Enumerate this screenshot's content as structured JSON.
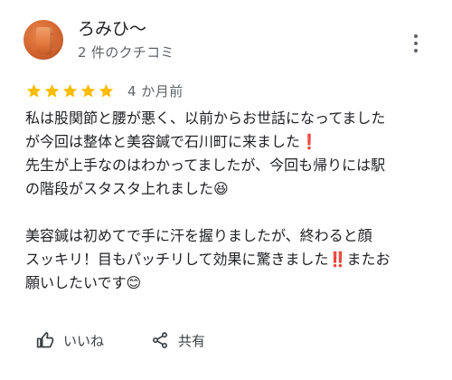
{
  "reviewer": {
    "name": "ろみひ〜",
    "review_count": "2 件のクチコミ",
    "avatar_icon": "profile-photo-mug"
  },
  "menu": {
    "icon": "more-vert-icon"
  },
  "rating": {
    "stars": 5,
    "max": 5,
    "star_color": "#fbbc04",
    "date": "4 か月前"
  },
  "review": {
    "lines": [
      "私は股関節と腰が悪く、以前からお世話になってましたが今回は整体と美容鍼で石川町に来ました❗",
      "先生が上手なのはわかってましたが、今回も帰りには駅の階段がスタスタ上れました😆",
      "",
      "美容鍼は初めてで手に汗を握りましたが、終わると顔スッキリ！目もパッチリして効果に驚きました‼️またお願いしたいです😊"
    ],
    "display_lines": [
      "私は股関節と腰が悪く、以前からお世話になってました",
      "が今回は整体と美容鍼で石川町に来ました❗",
      "先生が上手なのはわかってましたが、今回も帰りには駅",
      "の階段がスタスタ上れました😆",
      "",
      "美容鍼は初めてで手に汗を握りましたが、終わると顔",
      "スッキリ！目もパッチリして効果に驚きました‼️またお",
      "願いしたいです😊"
    ]
  },
  "actions": {
    "like_label": "いいね",
    "like_icon": "thumbs-up-icon",
    "share_label": "共有",
    "share_icon": "share-icon"
  }
}
